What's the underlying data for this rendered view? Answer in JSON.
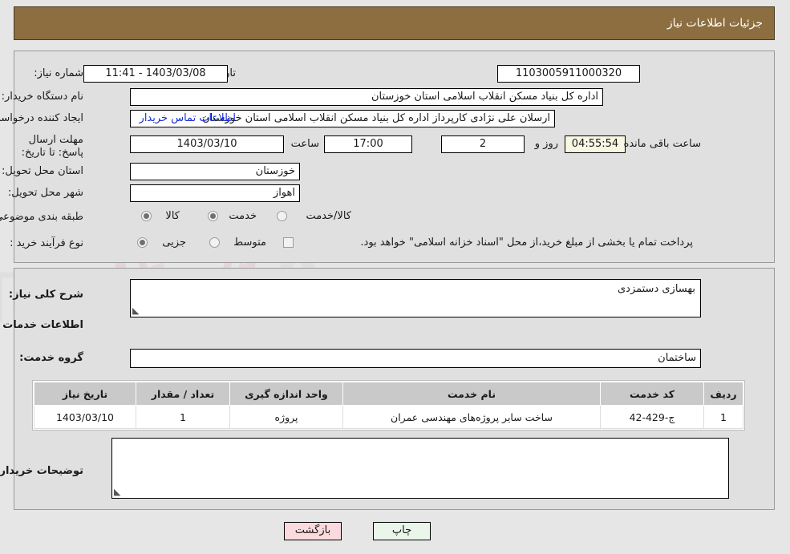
{
  "header": {
    "title": "جزئیات اطلاعات نیاز",
    "bar_color": "#8c6e41"
  },
  "form": {
    "need_number_label": "شماره نیاز:",
    "need_number_value": "1103005911000320",
    "announce_label": "تاریخ و ساعت اعلان عمومی:",
    "announce_value": "1403/03/08 - 11:41",
    "buyer_org_label": "نام دستگاه خریدار:",
    "buyer_org_value": "اداره کل بنیاد مسکن انقلاب اسلامی استان خوزستان",
    "creator_label": "ایجاد کننده درخواست:",
    "creator_value": "ارسلان علی نژادی کارپرداز اداره کل بنیاد مسکن انقلاب اسلامی استان خوزستان",
    "contact_link": "اطلاعات تماس خریدار",
    "deadline_label": "مهلت ارسال پاسخ: تا تاریخ:",
    "deadline_date": "1403/03/10",
    "deadline_hour_label": "ساعت",
    "deadline_hour_value": "17:00",
    "days_value": "2",
    "days_label": "روز و",
    "countdown_value": "04:55:54",
    "countdown_label": "ساعت باقی مانده",
    "province_label": "استان محل تحویل:",
    "province_value": "خوزستان",
    "city_label": "شهر محل تحویل:",
    "city_value": "اهواز",
    "category_label": "طبقه بندی موضوعی:",
    "category_options": [
      {
        "label": "کالا",
        "selected": false
      },
      {
        "label": "خدمت",
        "selected": true
      },
      {
        "label": "کالا/خدمت",
        "selected": false
      }
    ],
    "process_label": "نوع فرآیند خرید :",
    "process_options": [
      {
        "label": "جزیی",
        "selected": true
      },
      {
        "label": "متوسط",
        "selected": false
      }
    ],
    "treasury_checkbox_checked": false,
    "treasury_note": "پرداخت تمام یا بخشی از مبلغ خرید،از محل \"اسناد خزانه اسلامی\" خواهد بود."
  },
  "details": {
    "general_desc_label": "شرح کلی نیاز:",
    "general_desc_value": "بهسازی دستمزدی",
    "services_info_heading": "اطلاعات خدمات مورد نیاز",
    "service_group_label": "گروه خدمت:",
    "service_group_value": "ساختمان",
    "buyer_notes_label": "توضیحات خریدار:",
    "buyer_notes_value": ""
  },
  "table": {
    "columns": [
      "ردیف",
      "کد خدمت",
      "نام خدمت",
      "واحد اندازه گیری",
      "تعداد / مقدار",
      "تاریخ نیاز"
    ],
    "rows": [
      {
        "row": "1",
        "code": "ج-429-42",
        "name": "ساخت سایر پروژه‌های مهندسی عمران",
        "unit": "پروژه",
        "quantity": "1",
        "date": "1403/03/10"
      }
    ]
  },
  "footer": {
    "back_label": "بازگشت",
    "print_label": "چاپ",
    "back_color": "#fadadd",
    "print_color": "#eaf6ea"
  },
  "watermark": {
    "text": "AriaTender.net"
  }
}
